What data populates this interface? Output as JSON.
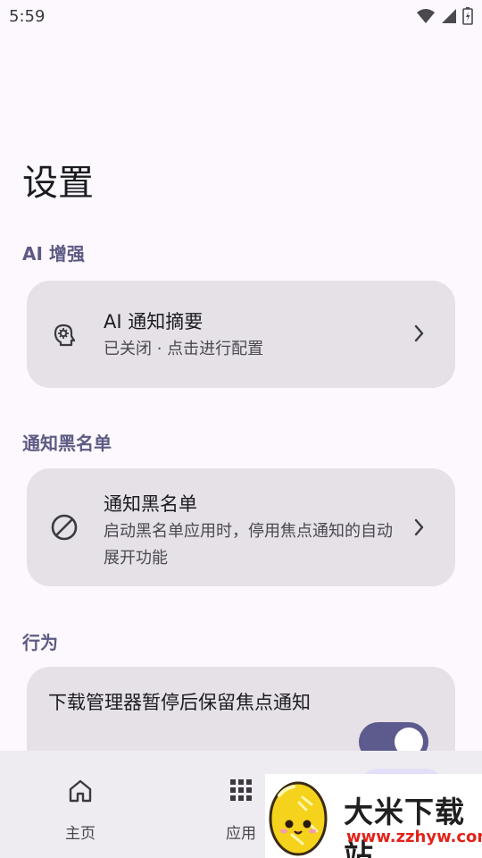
{
  "status_bar": {
    "time": "5:59",
    "icons": [
      "wifi-icon",
      "cellular-signal-icon",
      "battery-icon"
    ]
  },
  "page": {
    "title": "设置"
  },
  "sections": {
    "ai": {
      "header": "AI 增强",
      "card": {
        "icon": "brain-head-icon",
        "title": "AI 通知摘要",
        "subtitle": "已关闭 · 点击进行配置"
      }
    },
    "blacklist": {
      "header": "通知黑名单",
      "card": {
        "icon": "block-icon",
        "title": "通知黑名单",
        "subtitle": "启动黑名单应用时，停用焦点通知的自动展开功能"
      }
    },
    "behavior": {
      "header": "行为",
      "card": {
        "title": "下载管理器暂停后保留焦点通知",
        "toggle_on": true
      }
    }
  },
  "bottom_nav": {
    "items": [
      {
        "label": "主页",
        "icon": "home-icon"
      },
      {
        "label": "应用",
        "icon": "grid-icon"
      }
    ]
  },
  "watermark": {
    "title": "大米下载站",
    "url": "www.zzhyw.com"
  },
  "colors": {
    "accent": "#5d5a8e",
    "section_header": "#5d5a84",
    "card_bg": "#e5e1e7",
    "background": "#fcf8fd"
  }
}
